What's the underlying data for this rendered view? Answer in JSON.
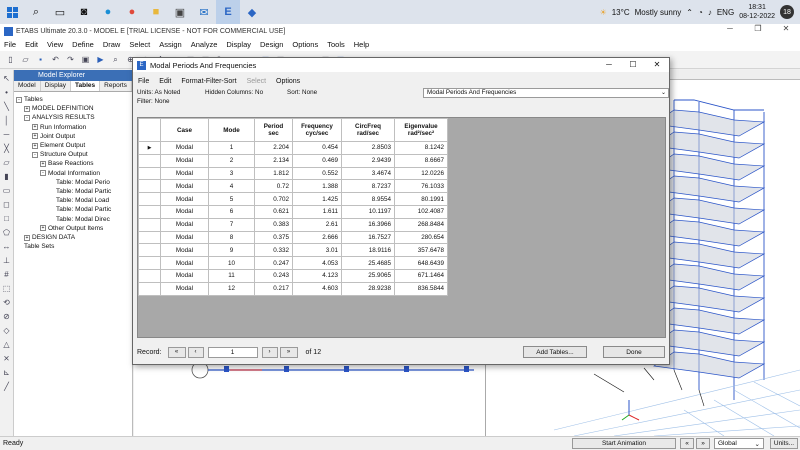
{
  "taskbar": {
    "temperature": "13°C",
    "weather": "Mostly sunny",
    "language": "ENG",
    "time": "18:31",
    "date": "08-12-2022",
    "notification_count": "18"
  },
  "app": {
    "title": "ETABS Ultimate 20.3.0 - MODEL E  [TRIAL LICENSE - NOT FOR COMMERCIAL USE]"
  },
  "menu": [
    "File",
    "Edit",
    "View",
    "Define",
    "Draw",
    "Select",
    "Assign",
    "Analyze",
    "Display",
    "Design",
    "Options",
    "Tools",
    "Help"
  ],
  "explorer": {
    "title": "Model Explorer",
    "tabs": [
      "Model",
      "Display",
      "Tables",
      "Reports"
    ],
    "active_tab": "Tables",
    "tree": [
      {
        "label": "Tables",
        "depth": 0,
        "expander": "-"
      },
      {
        "label": "MODEL DEFINITION",
        "depth": 1,
        "expander": "+"
      },
      {
        "label": "ANALYSIS RESULTS",
        "depth": 1,
        "expander": "-"
      },
      {
        "label": "Run Information",
        "depth": 2,
        "expander": "+"
      },
      {
        "label": "Joint Output",
        "depth": 2,
        "expander": "+"
      },
      {
        "label": "Element Output",
        "depth": 2,
        "expander": "+"
      },
      {
        "label": "Structure Output",
        "depth": 2,
        "expander": "-"
      },
      {
        "label": "Base Reactions",
        "depth": 3,
        "expander": "+"
      },
      {
        "label": "Modal Information",
        "depth": 3,
        "expander": "-"
      },
      {
        "label": "Table:  Modal Perio",
        "depth": 4,
        "expander": ""
      },
      {
        "label": "Table:  Modal Partic",
        "depth": 4,
        "expander": ""
      },
      {
        "label": "Table:  Modal Load",
        "depth": 4,
        "expander": ""
      },
      {
        "label": "Table:  Modal Partic",
        "depth": 4,
        "expander": ""
      },
      {
        "label": "Table:  Modal Direc",
        "depth": 4,
        "expander": ""
      },
      {
        "label": "Other Output Items",
        "depth": 3,
        "expander": "+"
      },
      {
        "label": "DESIGN DATA",
        "depth": 1,
        "expander": "+"
      },
      {
        "label": "Table Sets",
        "depth": 0,
        "expander": ""
      }
    ]
  },
  "dialog": {
    "title": "Modal Periods And Frequencies",
    "menu": [
      "File",
      "Edit",
      "Format-Filter-Sort",
      "Select",
      "Options"
    ],
    "units_label": "Units:  As Noted",
    "hidden_columns_label": "Hidden Columns:  No",
    "sort_label": "Sort:  None",
    "filter_label": "Filter:  None",
    "table_select_value": "Modal Periods And Frequencies",
    "columns": [
      {
        "line1": "Case",
        "line2": ""
      },
      {
        "line1": "Mode",
        "line2": ""
      },
      {
        "line1": "Period",
        "line2": "sec"
      },
      {
        "line1": "Frequency",
        "line2": "cyc/sec"
      },
      {
        "line1": "CircFreq",
        "line2": "rad/sec"
      },
      {
        "line1": "Eigenvalue",
        "line2": "rad²/sec²"
      }
    ],
    "rows": [
      [
        "Modal",
        "1",
        "2.204",
        "0.454",
        "2.8503",
        "8.1242"
      ],
      [
        "Modal",
        "2",
        "2.134",
        "0.469",
        "2.9439",
        "8.6667"
      ],
      [
        "Modal",
        "3",
        "1.812",
        "0.552",
        "3.4674",
        "12.0226"
      ],
      [
        "Modal",
        "4",
        "0.72",
        "1.388",
        "8.7237",
        "76.1033"
      ],
      [
        "Modal",
        "5",
        "0.702",
        "1.425",
        "8.9554",
        "80.1991"
      ],
      [
        "Modal",
        "6",
        "0.621",
        "1.611",
        "10.1197",
        "102.4087"
      ],
      [
        "Modal",
        "7",
        "0.383",
        "2.61",
        "16.3966",
        "268.8484"
      ],
      [
        "Modal",
        "8",
        "0.375",
        "2.666",
        "16.7527",
        "280.654"
      ],
      [
        "Modal",
        "9",
        "0.332",
        "3.01",
        "18.9116",
        "357.6478"
      ],
      [
        "Modal",
        "10",
        "0.247",
        "4.053",
        "25.4685",
        "648.6439"
      ],
      [
        "Modal",
        "11",
        "0.243",
        "4.123",
        "25.9065",
        "671.1464"
      ],
      [
        "Modal",
        "12",
        "0.217",
        "4.603",
        "28.9238",
        "836.5844"
      ]
    ],
    "record_label": "Record:",
    "record_value": "1",
    "record_total": "of 12",
    "add_tables_label": "Add Tables...",
    "done_label": "Done"
  },
  "statusbar": {
    "status": "Ready",
    "start_animation": "Start Animation",
    "coord_system": "Global",
    "units_button": "Units..."
  },
  "colors": {
    "accent": "#3b6fb6",
    "grid_background": "#a8a8a8"
  }
}
